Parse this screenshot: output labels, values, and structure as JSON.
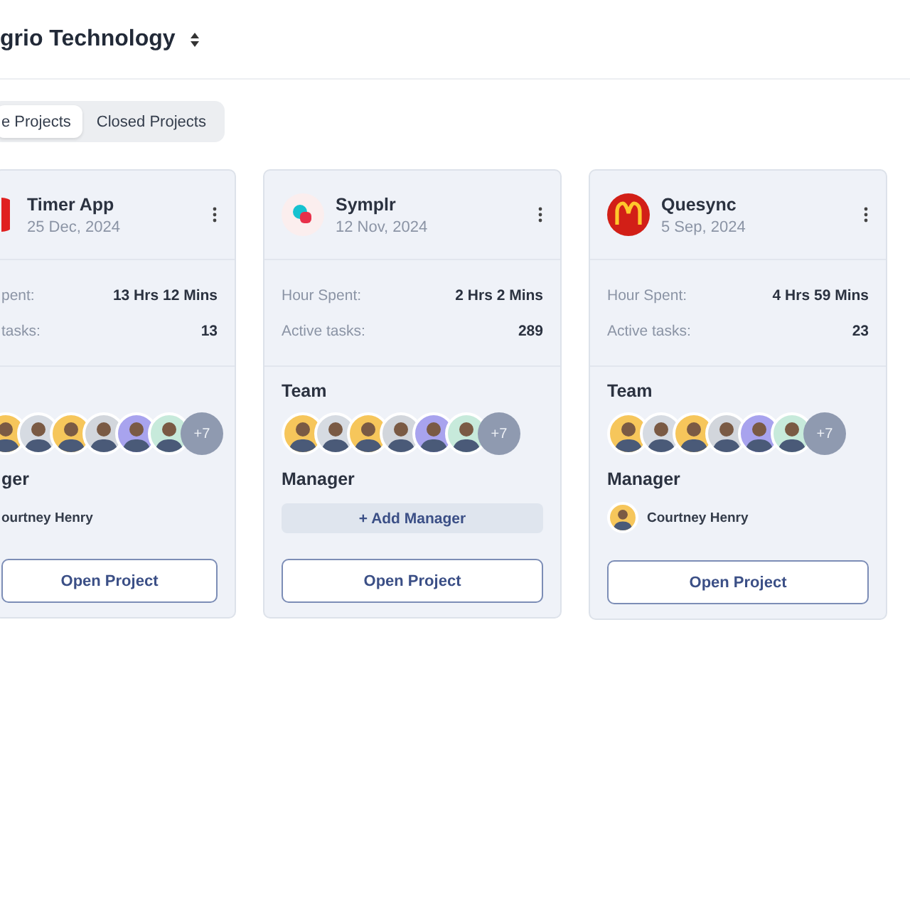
{
  "header": {
    "title": "grio Technology"
  },
  "tabs": [
    {
      "label": "e Projects",
      "selected": true
    },
    {
      "label": "Closed Projects",
      "selected": false
    }
  ],
  "projects": [
    {
      "kind": "cut",
      "logo": {
        "kind": "red-dot"
      },
      "name": "Timer App",
      "date": "25 Dec, 2024",
      "stats": [
        {
          "label": "pent:",
          "value": "13 Hrs 12 Mins"
        },
        {
          "label": "tasks:",
          "value": "13"
        }
      ],
      "team_extra": "+7",
      "manager_label": "ger",
      "manager": {
        "kind": "person",
        "name": "ourtney Henry"
      },
      "open_button": "Open Project"
    },
    {
      "kind": "full",
      "logo": {
        "kind": "blob"
      },
      "name": "Symplr",
      "date": "12 Nov, 2024",
      "stats": [
        {
          "label": "Hour Spent:",
          "value": "2 Hrs 2 Mins"
        },
        {
          "label": "Active tasks:",
          "value": "289"
        }
      ],
      "team_label": "Team",
      "team_extra": "+7",
      "manager_label": "Manager",
      "manager": {
        "kind": "add",
        "name": "+ Add Manager"
      },
      "open_button": "Open Project"
    },
    {
      "kind": "full",
      "logo": {
        "kind": "arches"
      },
      "name": "Quesync",
      "date": "5 Sep, 2024",
      "stats": [
        {
          "label": "Hour Spent:",
          "value": "4 Hrs 59 Mins"
        },
        {
          "label": "Active tasks:",
          "value": "23"
        }
      ],
      "team_label": "Team",
      "team_extra": "+7",
      "manager_label": "Manager",
      "manager": {
        "kind": "person",
        "name": "Courtney Henry"
      },
      "open_button": "Open Project"
    }
  ]
}
